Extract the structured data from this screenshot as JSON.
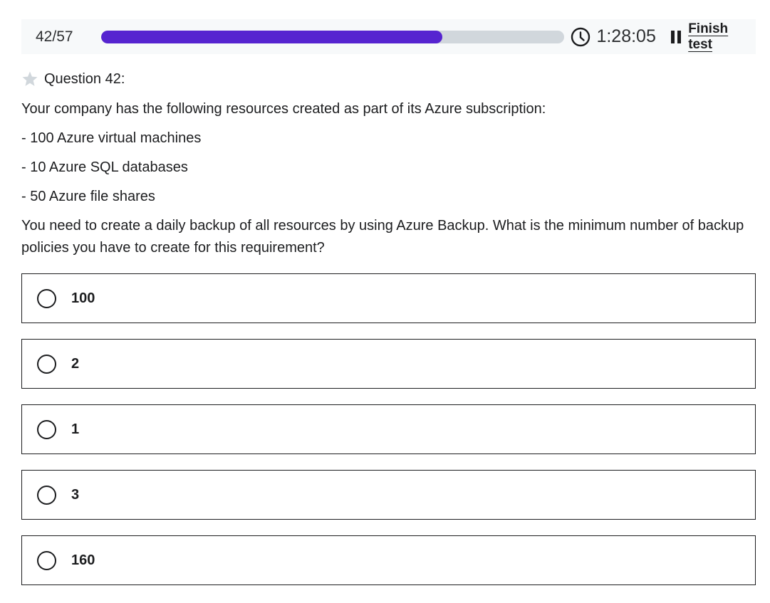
{
  "header": {
    "counter": "42/57",
    "progress_fraction": 0.7368,
    "timer": "1:28:05",
    "finish_label": "Finish test",
    "icons": {
      "timer": "clock-icon",
      "pause": "pause-icon"
    },
    "colors": {
      "progress_fill": "#5624d0",
      "progress_track": "#d1d7dc"
    }
  },
  "question": {
    "label": "Question 42:",
    "bookmark_icon": "star-icon",
    "lines": [
      "Your company has the following resources created as part of its Azure subscription:",
      "- 100 Azure virtual machines",
      "- 10 Azure SQL databases",
      "- 50 Azure file shares",
      "You need to create a daily backup of all resources by using Azure Backup. What is the minimum number of backup policies you have to create for this requirement?"
    ]
  },
  "options": [
    {
      "label": "100"
    },
    {
      "label": "2"
    },
    {
      "label": "1"
    },
    {
      "label": "3"
    },
    {
      "label": "160"
    }
  ]
}
